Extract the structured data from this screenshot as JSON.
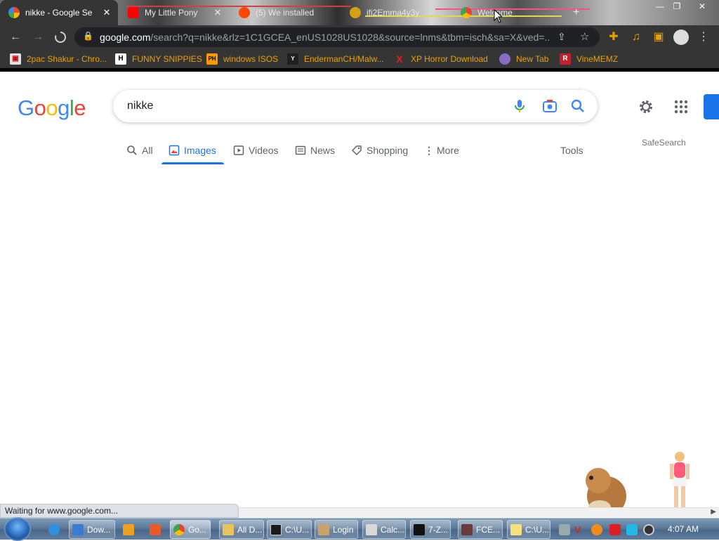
{
  "browser": {
    "tabs": [
      {
        "title": "nikke - Google Se",
        "active": true,
        "favicon": "google-icon"
      },
      {
        "title": "My Little Pony",
        "active": false,
        "favicon": "youtube-icon"
      },
      {
        "title": "(5) We installed",
        "active": false,
        "favicon": "reddit-icon"
      },
      {
        "title": "ifi2Emma4y3y",
        "active": false,
        "favicon": "coin-icon"
      },
      {
        "title": "Welcome",
        "active": false,
        "favicon": "chrome-icon"
      }
    ],
    "new_tab_glyph": "+",
    "address": {
      "domain": "google.com",
      "path": "/search?q=nikke&rlz=1C1GCEA_enUS1028US1028&source=lnms&tbm=isch&sa=X&ved=..."
    },
    "bookmarks": [
      {
        "label": "2pac Shakur - Chro...",
        "icon": "bag-icon",
        "color": "#e0e0e0"
      },
      {
        "label": "FUNNY SNIPPIES",
        "icon": "h-icon",
        "color": "#ffffff"
      },
      {
        "label": "windows ISOS",
        "icon": "ph-icon",
        "color": "#ff9900"
      },
      {
        "label": "EndermanCH/Malw...",
        "icon": "yt-icon",
        "color": "#202020"
      },
      {
        "label": "XP Horror Download",
        "icon": "x-icon",
        "color": "#e02020"
      },
      {
        "label": "New Tab",
        "icon": "planet-icon",
        "color": "#8a6cc4"
      },
      {
        "label": "VineMEMZ",
        "icon": "r-icon",
        "color": "#c4202c"
      }
    ],
    "bookmark_text_color": "#e8a000"
  },
  "google": {
    "logo": "Google",
    "query": "nikke",
    "tabs": [
      {
        "label": "All",
        "icon": "search-icon",
        "selected": false
      },
      {
        "label": "Images",
        "icon": "image-icon",
        "selected": true
      },
      {
        "label": "Videos",
        "icon": "play-icon",
        "selected": false
      },
      {
        "label": "News",
        "icon": "news-icon",
        "selected": false
      },
      {
        "label": "Shopping",
        "icon": "tag-icon",
        "selected": false
      },
      {
        "label": "More",
        "icon": "more-vert-icon",
        "selected": false
      }
    ],
    "tools_label": "Tools",
    "safesearch_label": "SafeSearch",
    "accent": "#1a73e8"
  },
  "status_text": "Waiting for www.google.com...",
  "taskbar": {
    "items": [
      {
        "label": "",
        "icon": "ie-icon",
        "pinned": true
      },
      {
        "label": "Dow...",
        "icon": "download-icon"
      },
      {
        "label": "",
        "icon": "media-icon",
        "pinned": true
      },
      {
        "label": "",
        "icon": "tool-icon",
        "pinned": true
      },
      {
        "label": "Go...",
        "icon": "chrome-icon",
        "active": true
      },
      {
        "label": "All D...",
        "icon": "folder-icon"
      },
      {
        "label": "C:\\U...",
        "icon": "cmd-icon"
      },
      {
        "label": "Login",
        "icon": "user-icon"
      },
      {
        "label": "Calc...",
        "icon": "calculator-icon"
      },
      {
        "label": "7-Z...",
        "icon": "7zip-icon"
      },
      {
        "label": "FCE...",
        "icon": "fce-icon"
      },
      {
        "label": "C:\\U...",
        "icon": "notepad-icon"
      }
    ],
    "clock": "4:07 AM"
  }
}
